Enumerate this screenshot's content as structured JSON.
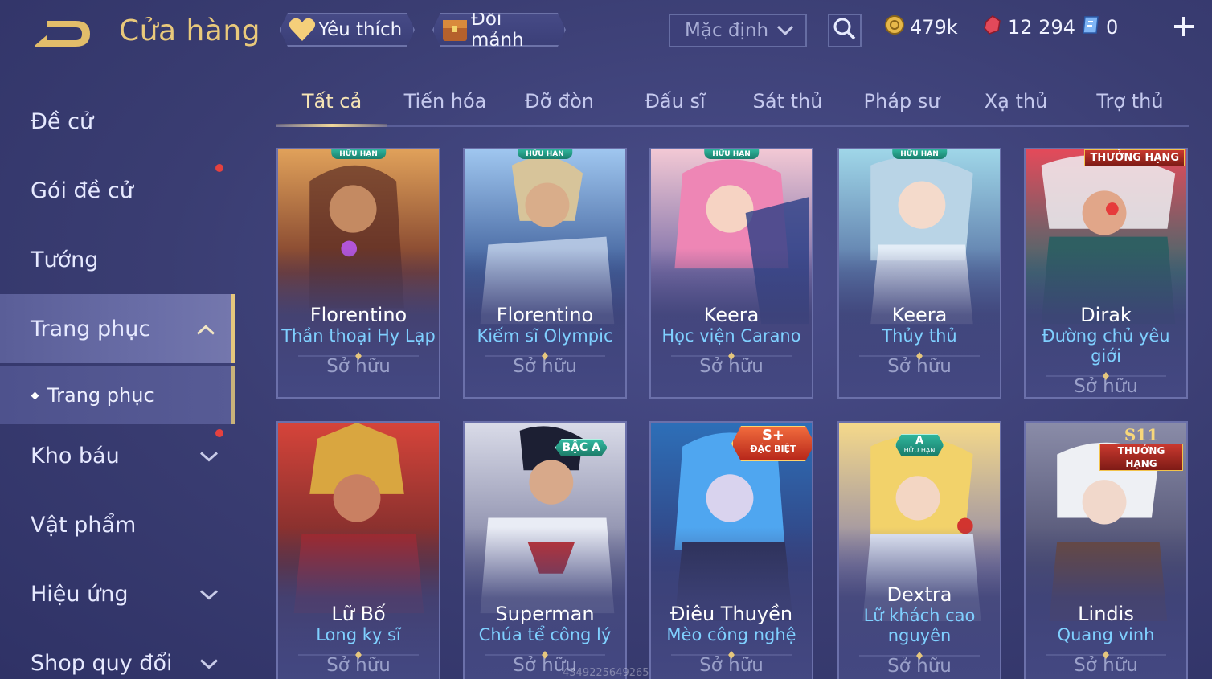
{
  "header": {
    "title": "Cửa hàng",
    "favorites_label": "Yêu thích",
    "shards_label": "Đổi mảnh",
    "sort_selected": "Mặc định",
    "currencies": {
      "gold": "479k",
      "ruby": "12 294",
      "token": "0"
    }
  },
  "sidebar": {
    "items": [
      {
        "label": "Đề cử"
      },
      {
        "label": "Gói đề cử"
      },
      {
        "label": "Tướng"
      },
      {
        "label": "Trang phục"
      },
      {
        "label": "Kho báu"
      },
      {
        "label": "Vật phẩm"
      },
      {
        "label": "Hiệu ứng"
      },
      {
        "label": "Shop quy đổi"
      }
    ],
    "sub_item": "Trang phục"
  },
  "tabs": [
    "Tất cả",
    "Tiến hóa",
    "Đỡ đòn",
    "Đấu sĩ",
    "Sát thủ",
    "Pháp sư",
    "Xạ thủ",
    "Trợ thủ"
  ],
  "cards": [
    {
      "hero": "Florentino",
      "skin": "Thần thoại Hy Lạp",
      "status": "Sở hữu",
      "badge": "HỮU HẠN"
    },
    {
      "hero": "Florentino",
      "skin": "Kiếm sĩ Olympic",
      "status": "Sở hữu",
      "badge": "HỮU HẠN"
    },
    {
      "hero": "Keera",
      "skin": "Học viện Carano",
      "status": "Sở hữu",
      "badge": "HỮU HẠN"
    },
    {
      "hero": "Keera",
      "skin": "Thủy thủ",
      "status": "Sở hữu",
      "badge": "HỮU HẠN"
    },
    {
      "hero": "Dirak",
      "skin": "Đường chủ yêu giới",
      "status": "Sở hữu",
      "badge": "THƯỞNG HẠNG"
    },
    {
      "hero": "Lữ Bố",
      "skin": "Long kỵ sĩ",
      "status": "Sở hữu",
      "badge": ""
    },
    {
      "hero": "Superman",
      "skin": "Chúa tể công lý",
      "status": "Sở hữu",
      "badge": "BẬC A"
    },
    {
      "hero": "Điêu Thuyền",
      "skin": "Mèo công nghệ",
      "status": "Sở hữu",
      "badge_main": "S+",
      "badge_sub": "ĐẶC BIỆT"
    },
    {
      "hero": "Dextra",
      "skin": "Lữ khách cao nguyên",
      "status": "Sở hữu",
      "badge_main": "A",
      "badge_sub": "HỮU HẠN"
    },
    {
      "hero": "Lindis",
      "skin": "Quang vinh",
      "status": "Sở hữu",
      "badge_main": "S11",
      "badge_sub": "THƯỞNG HẠNG"
    }
  ],
  "watermark": "4349225649265",
  "colors": {
    "background": "#3a3d72",
    "title_gold": "#e9c97b",
    "skin_blue": "#7fd0ff",
    "notification_red": "#e5413f",
    "rank_teal": "#2fb59c"
  }
}
